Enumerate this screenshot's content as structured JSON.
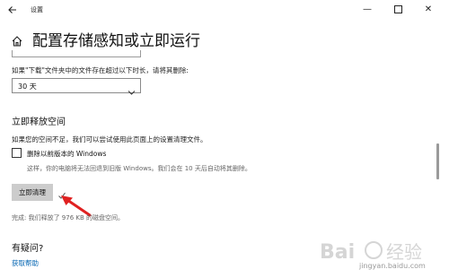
{
  "window": {
    "title": "设置",
    "back_icon": "back-arrow-icon",
    "minimize_icon": "minimize-icon",
    "maximize_icon": "maximize-icon",
    "close_icon": "close-icon",
    "minimize_glyph": "—",
    "close_glyph": "✕"
  },
  "page": {
    "title": "配置存储感知或立即运行",
    "home_icon": "home-icon"
  },
  "downloads": {
    "prompt": "如果\"下载\"文件夹中的文件存在超过以下时长，请将其删除:",
    "selected_option": "30 天"
  },
  "free_space": {
    "heading": "立即释放空间",
    "description": "如果您的空间不足，我们可以尝试使用此页面上的设置清理文件。",
    "checkbox_label": "删除以前版本的 Windows",
    "checkbox_checked": false,
    "checkbox_note": "这样，你的电脑将无法回退到旧版 Windows。我们会在 10 天后自动将其删除。",
    "clean_button": "立即清理",
    "result": "完成: 我们释放了 976 KB 的磁盘空间。"
  },
  "help": {
    "heading": "有疑问?",
    "link": "获取帮助"
  },
  "colors": {
    "link": "#0063b1",
    "button_bg": "#cccccc",
    "arrow": "#e02020",
    "check": "#555555"
  },
  "watermark": {
    "text": "jingyan.baidu.com"
  }
}
